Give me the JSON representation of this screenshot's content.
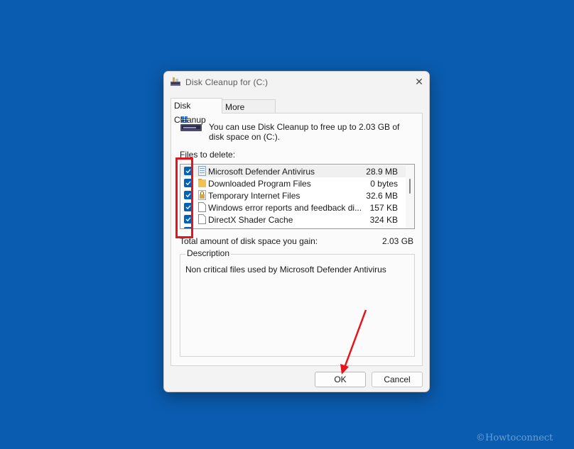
{
  "window": {
    "title": "Disk Cleanup for  (C:)",
    "close_glyph": "✕"
  },
  "tabs": [
    {
      "label": "Disk Cleanup",
      "active": true
    },
    {
      "label": "More Options",
      "active": false
    }
  ],
  "intro": "You can use Disk Cleanup to free up to 2.03 GB of disk space on  (C:).",
  "files_label": "Files to delete:",
  "files": [
    {
      "name": "Microsoft Defender Antivirus",
      "size": "28.9 MB",
      "checked": true,
      "icon": "defender-file-icon"
    },
    {
      "name": "Downloaded Program Files",
      "size": "0 bytes",
      "checked": true,
      "icon": "folder-icon"
    },
    {
      "name": "Temporary Internet Files",
      "size": "32.6 MB",
      "checked": true,
      "icon": "lock-icon"
    },
    {
      "name": "Windows error reports and feedback di...",
      "size": "157 KB",
      "checked": true,
      "icon": "document-icon"
    },
    {
      "name": "DirectX Shader Cache",
      "size": "324 KB",
      "checked": true,
      "icon": "document-icon"
    }
  ],
  "total": {
    "label": "Total amount of disk space you gain:",
    "value": "2.03 GB"
  },
  "description": {
    "legend": "Description",
    "text": "Non critical files used by Microsoft Defender Antivirus"
  },
  "buttons": {
    "ok": "OK",
    "cancel": "Cancel"
  },
  "watermark": "©Howtoconnect",
  "colors": {
    "desktop": "#0a5cb0",
    "checkbox": "#0063b8",
    "annotation": "#e8141b"
  }
}
